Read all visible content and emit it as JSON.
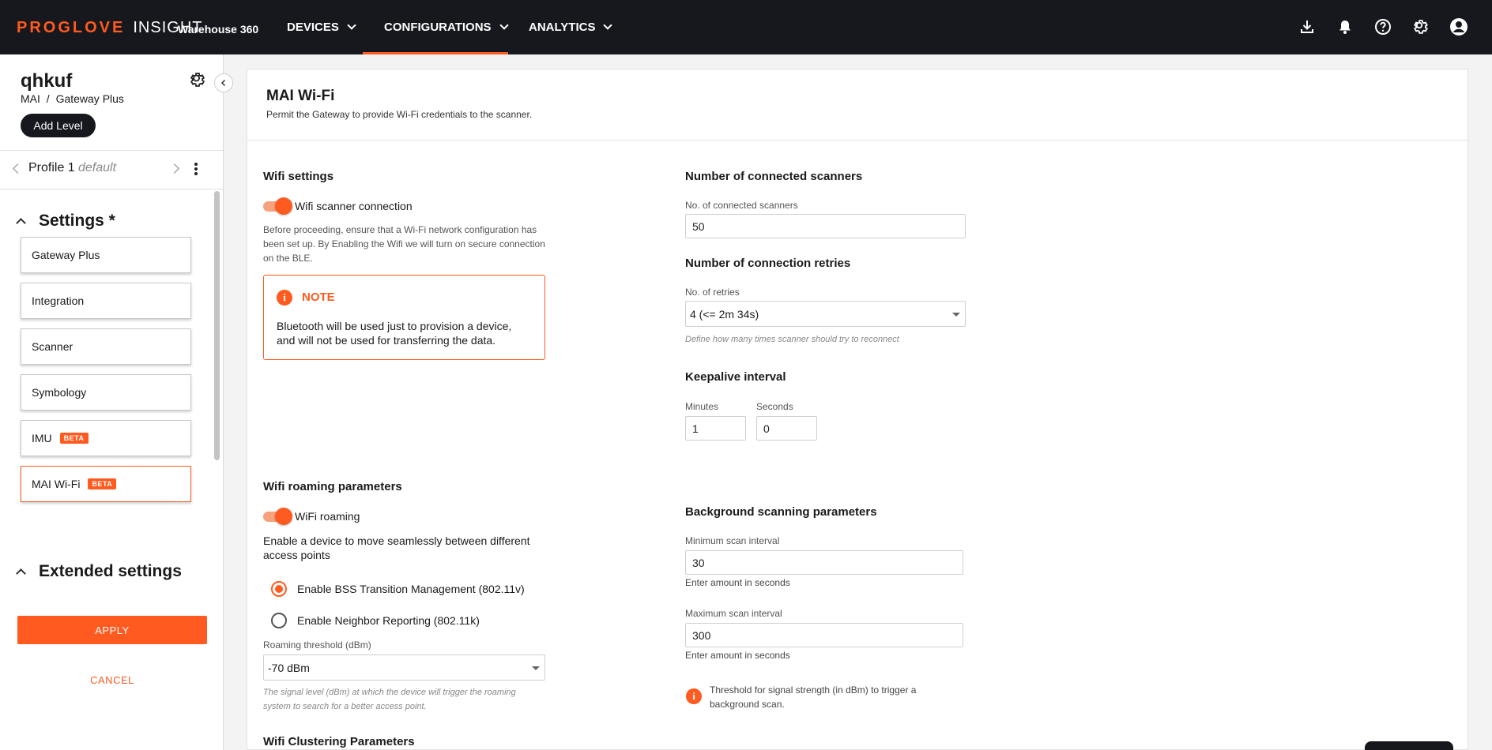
{
  "brand": {
    "name": "PROGLOVE",
    "product": "INSIGHT",
    "workspace": "Warehouse 360",
    "accent": "#ff5a1f"
  },
  "nav": {
    "devices": "DEVICES",
    "configurations": "CONFIGURATIONS",
    "analytics": "ANALYTICS"
  },
  "sidebar": {
    "title": "qhkuf",
    "path_root": "MAI",
    "path_sep": "/",
    "path_leaf": "Gateway Plus",
    "add_level": "Add Level",
    "profile_name": "Profile 1",
    "profile_default": "default",
    "settings_header": "Settings *",
    "items": [
      {
        "label": "Gateway Plus",
        "beta": ""
      },
      {
        "label": "Integration",
        "beta": ""
      },
      {
        "label": "Scanner",
        "beta": ""
      },
      {
        "label": "Symbology",
        "beta": ""
      },
      {
        "label": "IMU",
        "beta": "BETA"
      },
      {
        "label": "MAI Wi-Fi",
        "beta": "BETA"
      }
    ],
    "extended_header": "Extended settings",
    "apply": "APPLY",
    "cancel": "CANCEL"
  },
  "main": {
    "title": "MAI Wi-Fi",
    "subtitle": "Permit the Gateway to provide Wi-Fi credentials to the scanner.",
    "wifi_settings": {
      "header": "Wifi settings",
      "toggle_label": "Wifi scanner connection",
      "toggle_on": true,
      "desc": "Before proceeding, ensure that a Wi-Fi network configuration has been set up. By Enabling the Wifi we will turn on secure connection on the BLE.",
      "note_title": "NOTE",
      "note_text": "Bluetooth will be used just to provision a device, and will not be used for transferring the data."
    },
    "connected": {
      "header": "Number of connected scanners",
      "label": "No. of connected scanners",
      "value": "50"
    },
    "retries": {
      "header": "Number of connection retries",
      "label": "No. of retries",
      "value": "4 (<= 2m 34s)",
      "help": "Define how many times scanner should try to reconnect"
    },
    "keepalive": {
      "header": "Keepalive interval",
      "minutes_label": "Minutes",
      "minutes_value": "1",
      "seconds_label": "Seconds",
      "seconds_value": "0"
    },
    "roaming": {
      "header": "Wifi roaming parameters",
      "toggle_label": "WiFi roaming",
      "toggle_on": true,
      "desc": "Enable a device to move seamlessly between different access points",
      "radio1": "Enable BSS Transition Management (802.11v)",
      "radio2": "Enable Neighbor Reporting (802.11k)",
      "selected_radio": 1,
      "threshold_label": "Roaming threshold (dBm)",
      "threshold_value": "-70 dBm",
      "threshold_help": "The signal level (dBm) at which the device will trigger the roaming system to search for a better access point."
    },
    "background": {
      "header": "Background scanning parameters",
      "min_label": "Minimum scan interval",
      "min_value": "30",
      "min_help": "Enter amount in seconds",
      "max_label": "Maximum scan interval",
      "max_value": "300",
      "max_help": "Enter amount in seconds",
      "info": "Threshold for signal strength (in dBm) to trigger a background scan."
    },
    "clustering_header": "Wifi Clustering Parameters"
  }
}
